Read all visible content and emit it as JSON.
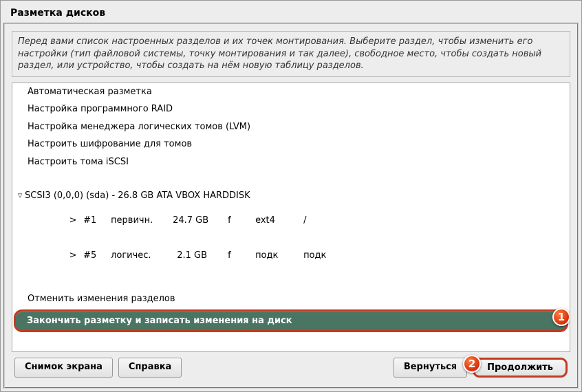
{
  "title": "Разметка дисков",
  "description": "Перед вами список настроенных разделов и их точек монтирования. Выберите раздел, чтобы изменить его настройки (тип файловой системы, точку монтирования и так далее), свободное место, чтобы создать новый раздел, или устройство, чтобы создать на нём новую таблицу разделов.",
  "menu": {
    "guided": "Автоматическая разметка",
    "raid": "Настройка программного RAID",
    "lvm": "Настройка менеджера логических томов (LVM)",
    "crypt": "Настроить шифрование для томов",
    "iscsi": "Настроить тома iSCSI",
    "undo": "Отменить изменения разделов",
    "finish": "Закончить разметку и записать изменения на диск"
  },
  "disk": {
    "label": "SCSI3 (0,0,0) (sda) - 26.8 GB ATA VBOX HARDDISK",
    "partitions": [
      {
        "gt": ">",
        "num": "#1",
        "type": "первичн.",
        "size": "24.7 GB",
        "flag": "f",
        "fs": "ext4",
        "mount": "/"
      },
      {
        "gt": ">",
        "num": "#5",
        "type": "логичес.",
        "size": "2.1 GB",
        "flag": "f",
        "fs": "подк",
        "mount": "подк"
      }
    ]
  },
  "buttons": {
    "screenshot": "Снимок экрана",
    "help": "Справка",
    "back": "Вернуться",
    "continue": "Продолжить"
  },
  "badges": {
    "b1": "1",
    "b2": "2"
  }
}
